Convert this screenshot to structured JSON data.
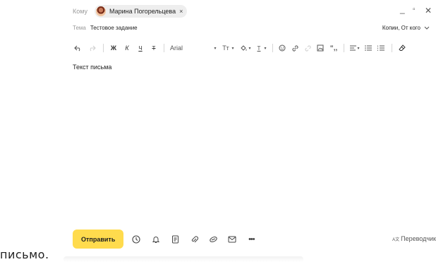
{
  "header": {
    "to_label": "Кому",
    "recipient_name": "Марина Погорельцева",
    "recipient_remove": "×",
    "minimize": "_",
    "restore": "▫",
    "close": "✕",
    "subject_label": "Тема",
    "subject_value": "Тестовое задание",
    "copies_label": "Копии, От кого"
  },
  "toolbar": {
    "bold": "Ж",
    "italic": "К",
    "underline": "Ч",
    "strike": "Т",
    "font": "Arial",
    "font_size": "Тт",
    "text_color": "Т"
  },
  "body": {
    "text": "Текст письма"
  },
  "footer": {
    "send_label": "Отправить",
    "translator_label": "Переводчик"
  },
  "overlay": {
    "text": "письмо."
  },
  "colors": {
    "send_button": "#ffdb4d",
    "muted_text": "#9a9a9a"
  }
}
